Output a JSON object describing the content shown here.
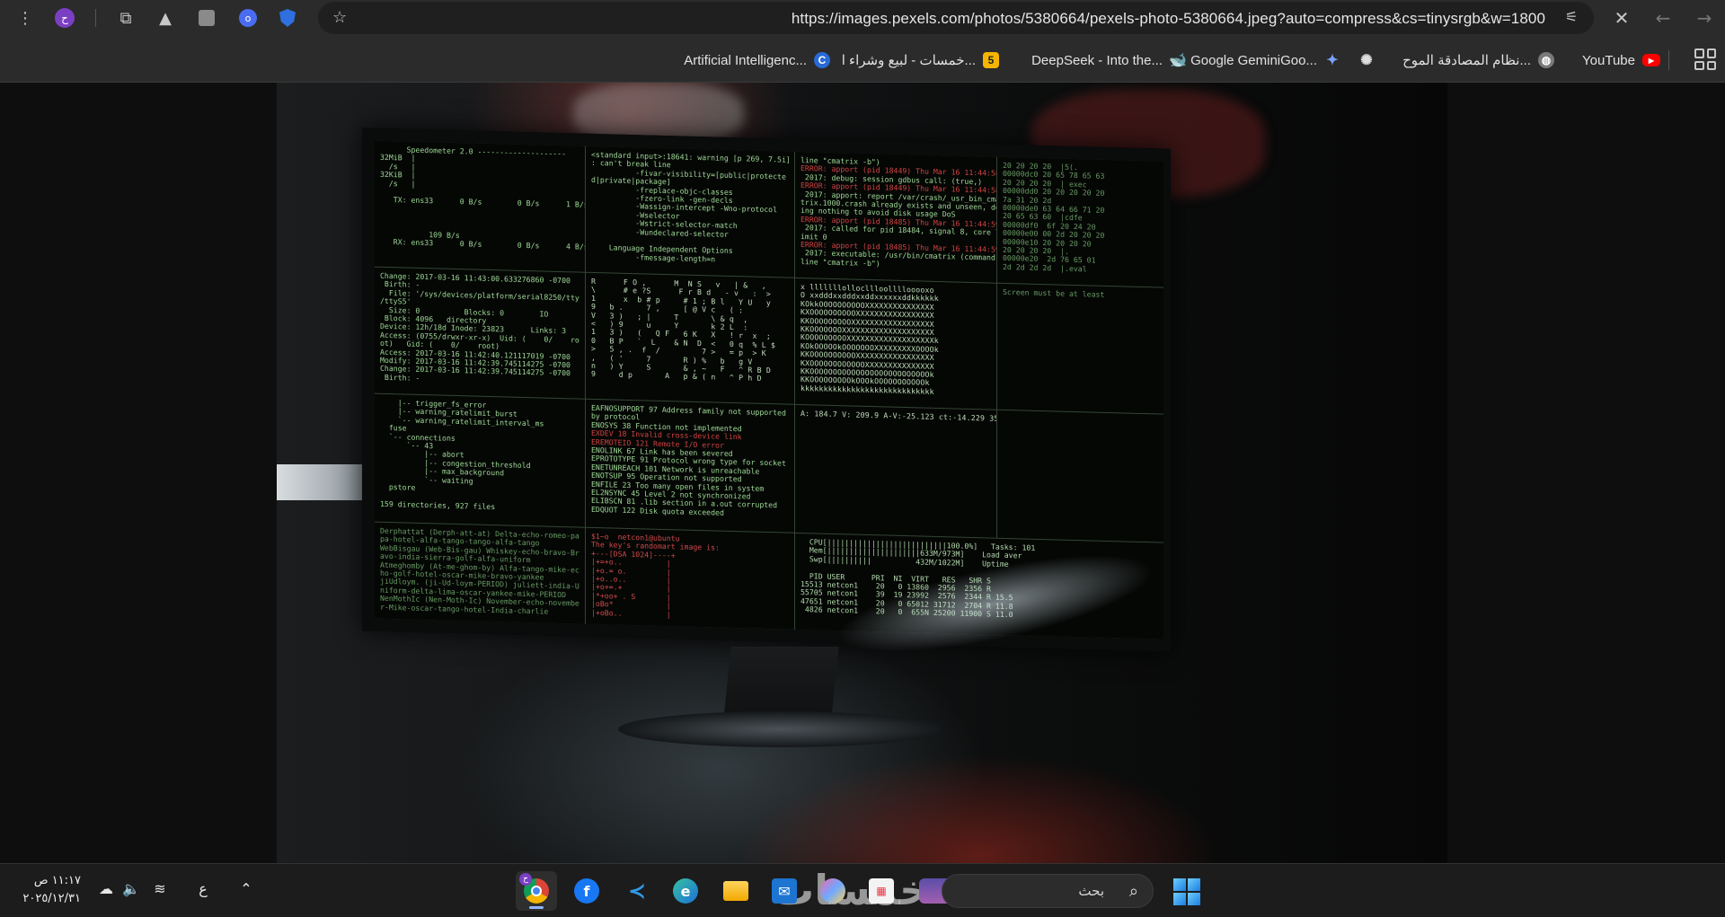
{
  "browser": {
    "url": "https://images.pexels.com/photos/5380664/pexels-photo-5380664.jpeg?auto=compress&cs=tinysrgb&w=1800",
    "profile_letter": "ح",
    "ghost_ext_letter": "o"
  },
  "bookmarks": [
    {
      "label": "YouTube",
      "icon": "youtube-icon",
      "color": "#ff0000"
    },
    {
      "label": "نظام المصادقة الموح...",
      "icon": "globe-icon",
      "color": "#8a8a8a"
    },
    {
      "label": "",
      "icon": "openai-icon",
      "color": "#cccccc"
    },
    {
      "label": "Google GeminiGoo...",
      "icon": "gemini-icon",
      "color": "#6b8cff"
    },
    {
      "label": "DeepSeek - Into the...",
      "icon": "deepseek-icon",
      "color": "#4d6bfe"
    },
    {
      "label": "خمسات - لبيع وشراء ا...",
      "icon": "khamsat-icon",
      "color": "#f5b400",
      "badge": "5"
    },
    {
      "label": "Artificial Intelligenc...",
      "icon": "c-logo-icon",
      "color": "#2a6ad6",
      "badge": "C"
    }
  ],
  "terminal": {
    "pane1": "      Speedometer 2.0 --------------------\n32MiB  |\n  /s   |\n32KiB  |\n  /s   |\n\n   TX: ens33      0 B/s        0 B/s      1 B/s\n\n\n\n           109 B/s\n   RX: ens33      0 B/s        0 B/s      4 B/s",
    "pane2": "<standard input>:18641: warning [p 269, 7.5i]\n: can't break line\n          -fivar-visibility=[public|protecte\nd|private|package]\n          -freplace-objc-classes\n          -fzero-link -gen-decls\n          -Wassign-intercept -Wno-protocol\n          -Wselector\n          -Wstrict-selector-match\n          -Wundeclared-selector\n\n    Language Independent Options\n          -fmessage-length=n",
    "pane3_lines": [
      {
        "t": "line \"cmatrix -b\")",
        "e": false
      },
      {
        "t": "ERROR: apport (pid 18449) Thu Mar 16 11:44:58",
        "e": true
      },
      {
        "t": " 2017: debug: session gdbus call: (true,)",
        "e": false
      },
      {
        "t": "",
        "e": false
      },
      {
        "t": "ERROR: apport (pid 18449) Thu Mar 16 11:44:58",
        "e": true
      },
      {
        "t": " 2017: apport: report /var/crash/_usr_bin_cma",
        "e": false
      },
      {
        "t": "trix.1000.crash already exists and unseen, do",
        "e": false
      },
      {
        "t": "ing nothing to avoid disk usage DoS",
        "e": false
      },
      {
        "t": "ERROR: apport (pid 18485) Thu Mar 16 11:44:59",
        "e": true
      },
      {
        "t": " 2017: called for pid 18484, signal 8, core l",
        "e": false
      },
      {
        "t": "imit 0",
        "e": false
      },
      {
        "t": "ERROR: apport (pid 18485) Thu Mar 16 11:44:59",
        "e": true
      },
      {
        "t": " 2017: executable: /usr/bin/cmatrix (command",
        "e": false
      },
      {
        "t": "line \"cmatrix -b\")",
        "e": false
      }
    ],
    "pane4": "20 20 20 20  |5(.\n00000dc0 20 65 78 65 63\n20 20 20 20  | exec\n00000dd0 20 20 20 20 20\n7a 31 20 2d\n00000de0 63 64 66 71 20\n20 65 63 60  |cdfe\n00000df0  6f 20 24 20\n00000e00 00 2d 20 20 20\n00000e10 20 20 20 20\n20 20 20 20  |.\n00000e20  2d 76 65 01\n2d 2d 2d 2d  |.eval",
    "pane5": "Change: 2017-03-16 11:43:00.633276860 -0700\n Birth: -\n  File: '/sys/devices/platform/serial8250/tty\n/ttyS5'\n  Size: 0          Blocks: 0        IO\n Block: 4096   directory\nDevice: 12h/18d Inode: 23823      Links: 3\nAccess: (0755/drwxr-xr-x)  Uid: (    0/    ro\not)   Gid: (    0/    root)\nAccess: 2017-03-16 11:42:40.121117019 -0700\nModify: 2017-03-16 11:42:39.745114275 -0700\nChange: 2017-03-16 11:42:39.745114275 -0700\n Birth: -",
    "pane6": "R      F O ,      M  N S   v   | &   ,\n\\      # e ?S      F r B d   - v   :  >\n1      x  b # p     # 1 ; B l   Y U   y\n9   b .     7 ,     [ @ V c   ( :\nV   3 )   ; |     T       \\ & q  ,\n<   ) 9     u     Y       k 2 L  :\n1   3 )   (   Q F   6 K   X   ! r  x  ;\n0   B P   `  L    & N  D  <   0 q  % L $\n>   5 , .  f  /         7 >   = p  > K\n,   ( '     7       R ) %   b   g V\nn   ) Y     S       & , ~   F   ^ R B D\n9     d p       A   p & ( n   ^ P h D",
    "pane7": "x lllllllollocllloollllooooxo\nO xxdddxxdddxxddxxxxxxddkkkkkk\nKOkkOOOOOOOOOOXXXXXXXXXXXXXXX\nKXOOOOOOOOOOXXXXXXXXXXXXXXXXX\nKKOOOOOOOOOXXXXXXXXXXXXXXXXXX\nKKOOOOOOOXXXXXXXXXXXXXXXXXXXX\nKOOOOOOOOOXXXXXXXXXXXXXXXXXXXk\nKOkOOOOOkOOOOOOOXXXXXXXXXOOOOk\nKKOOOOOOOOOOXXXXXXXXXXXXXXXXX\nKXOOOOOOOOOOOOXXXXXXXXXXXXXXX\nKKOOOOOOOOOOOOOOOOOOOOOOOOOOk\nKKOOOOOOOOOkOOOkOOOOOOOOOOOk\nkkkkkkkkkkkkkkkkkkkkkkkkkkkkk",
    "pane8": "Screen must be at least",
    "pane9": "    |-- trigger_fs_error\n    |-- warning_ratelimit_burst\n    `-- warning_ratelimit_interval_ms\n  fuse\n  `-- connections\n      `-- 43\n          |-- abort\n          |-- congestion_threshold\n          |-- max_background\n          `-- waiting\n  pstore\n\n159 directories, 927 files",
    "pane10_lines": [
      {
        "t": "EAFNOSUPPORT 97 Address family not supported",
        "e": false
      },
      {
        "t": "by protocol",
        "e": false
      },
      {
        "t": "ENOSYS 38 Function not implemented",
        "e": false
      },
      {
        "t": "EXDEV 18 Invalid cross-device link",
        "e": true
      },
      {
        "t": "EREMOTEIO 121 Remote I/O error",
        "e": true
      },
      {
        "t": "ENOLINK 67 Link has been severed",
        "e": false
      },
      {
        "t": "EPROTOTYPE 91 Protocol wrong type for socket",
        "e": false
      },
      {
        "t": "ENETUNREACH 101 Network is unreachable",
        "e": false
      },
      {
        "t": "ENOTSUP 95 Operation not supported",
        "e": false
      },
      {
        "t": "ENFILE 23 Too many open files in system",
        "e": false
      },
      {
        "t": "EL2NSYNC 45 Level 2 not synchronized",
        "e": false
      },
      {
        "t": "ELIBSCN 81 .lib section in a.out corrupted",
        "e": false
      },
      {
        "t": "EDQUOT 122 Disk quota exceeded",
        "e": false
      }
    ],
    "pane11": "A: 184.7 V: 209.9 A-V:-25.123 ct:-14.229 354",
    "pane12": "",
    "pane13": "Derphattat (Derph-att-at) Delta-echo-romeo-pa\npa-hotel-alfa-tango-tango-alfa-tango\nWebBisgau (Web-Bis-gau) Whiskey-echo-bravo-Br\navo-india-sierra-golf-alfa-uniform\nAtmeghomby (At-me-ghom-by) Alfa-tango-mike-ec\nho-golf-hotel-oscar-mike-bravo-yankee\njiUdloym. (ji-Ud-loym-PERIOD) juliett-india-U\nniform-delta-lima-oscar-yankee-mike-PERIOD\nNenMothIc (Nen-Moth-Ic) November-echo-novembe\nr-Mike-oscar-tango-hotel-India-charlie",
    "pane14": "$1~o  netcon1@ubuntu\nThe key's randomart image is:\n+---[DSA 1024]----+\n|+=+o..          |\n|+o.= o.         |\n|+o..o..         |\n|+o+=.+          |\n|*+oo+ . S       |\n|oBo*            |\n|+oBo..          |",
    "pane15": "  CPU[|||||||||||||||||||||||||||100.0%]   Tasks: 101\n  Mem[|||||||||||||||||||||633M/973M]    Load aver\n  Swp[||||||||||          432M/1022M]    Uptime\n\n  PID USER      PRI  NI  VIRT   RES   SHR S\n15513 netcon1    20   0 13860  2956  2356 R\n55705 netcon1    39  19 23992  2576  2344 R 15.5\n47651 netcon1    20   0 65012 31712  2704 R 11.8\n 4826 netcon1    20   0  655N 25200 11900 S 11.0",
    "pane16": ""
  },
  "taskbar": {
    "time": "١١:١٧ ص",
    "date": "٢٠٢٥/١٢/٣١",
    "ime": "ع",
    "search_placeholder": "بحث",
    "watermark": "خمسات",
    "chrome_badge": "ح"
  }
}
